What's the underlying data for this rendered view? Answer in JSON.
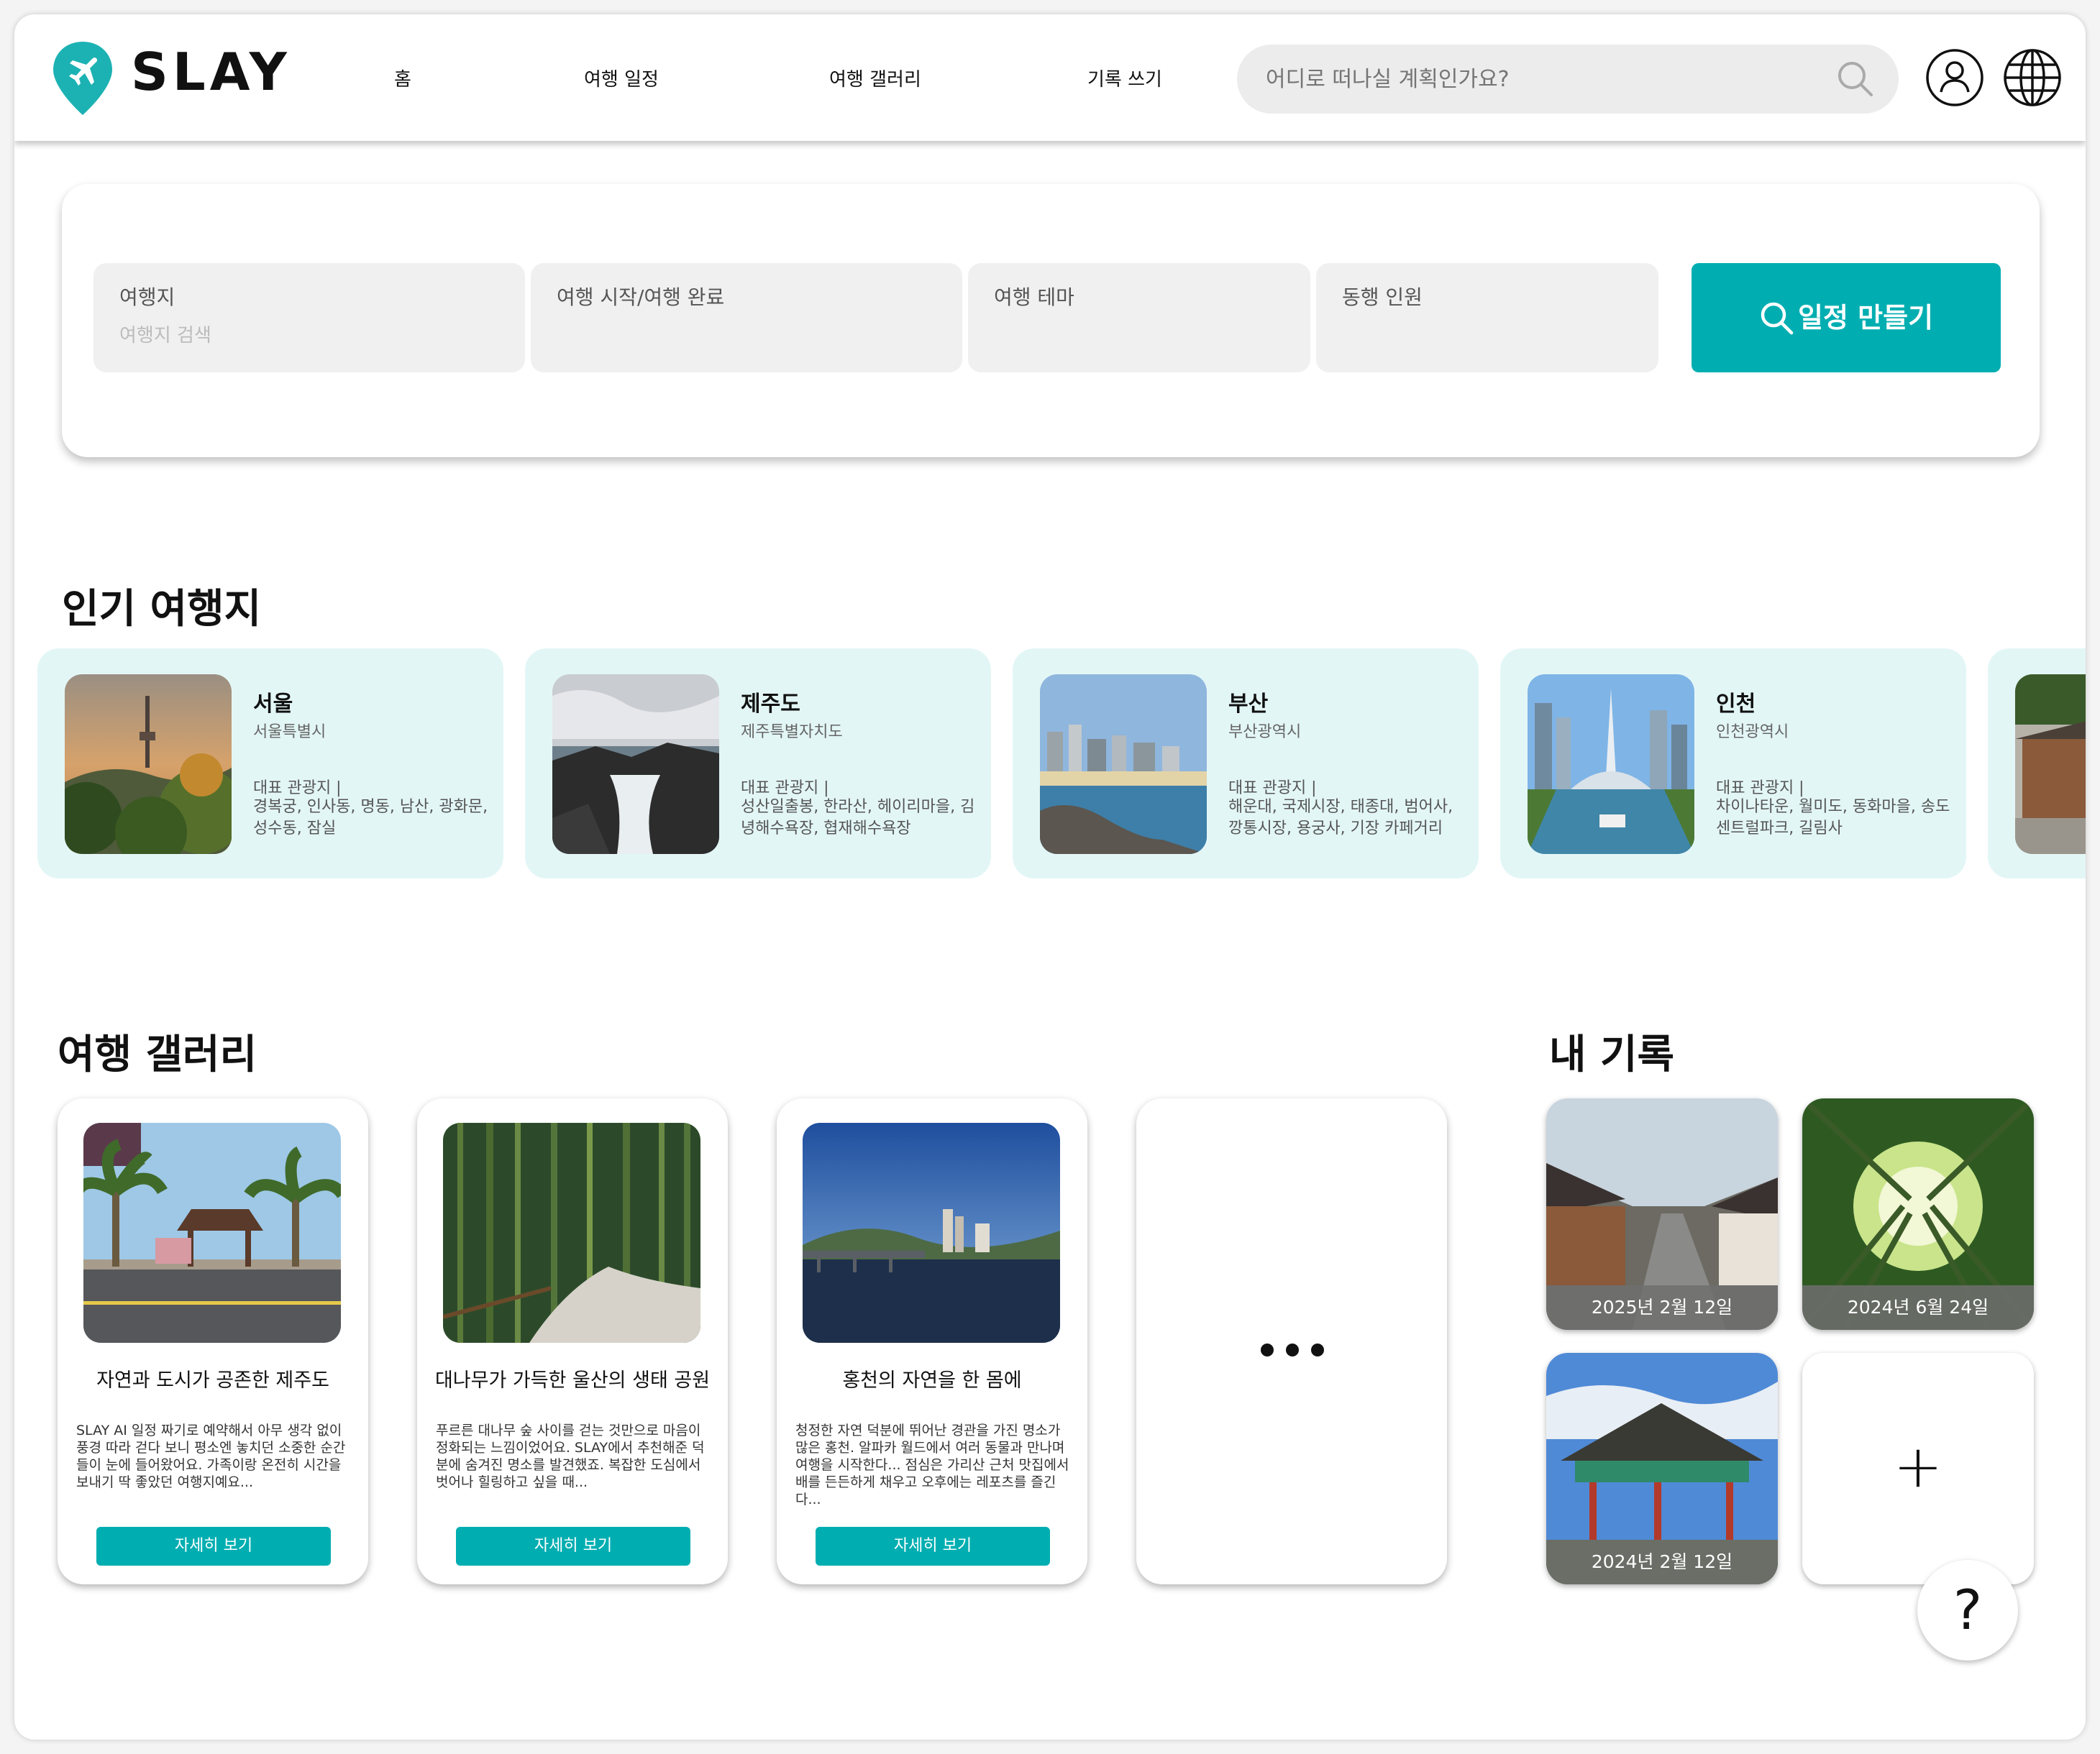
{
  "brand": {
    "name": "SLAY",
    "accent": "#00aeb1"
  },
  "nav": {
    "items": [
      "홈",
      "여행 일정",
      "여행 갤러리",
      "기록 쓰기"
    ]
  },
  "search": {
    "placeholder": "어디로 떠나실 계획인가요?"
  },
  "header_icons": [
    "search-icon",
    "user-icon",
    "globe-icon"
  ],
  "planner": {
    "destination": {
      "label": "여행지",
      "placeholder": "여행지 검색"
    },
    "dates": {
      "label": "여행 시작/여행 완료"
    },
    "theme": {
      "label": "여행 테마"
    },
    "companions": {
      "label": "동행 인원"
    },
    "create_button": "일정 만들기"
  },
  "popular": {
    "title": "인기 여행지",
    "items": [
      {
        "name": "서울",
        "region": "서울특별시",
        "highlight": "대표 관광지 |",
        "spots": "경복궁, 인사동, 명동, 남산, 광화문, 성수동, 잠실"
      },
      {
        "name": "제주도",
        "region": "제주특별자치도",
        "highlight": "대표 관광지 |",
        "spots": "성산일출봉, 한라산, 헤이리마을, 김녕해수욕장, 협재해수욕장"
      },
      {
        "name": "부산",
        "region": "부산광역시",
        "highlight": "대표 관광지 |",
        "spots": "해운대, 국제시장, 태종대, 범어사, 깡통시장, 용궁사, 기장 카페거리"
      },
      {
        "name": "인천",
        "region": "인천광역시",
        "highlight": "대표 관광지 |",
        "spots": "차이나타운, 월미도, 동화마을, 송도 센트럴파크, 길림사"
      }
    ]
  },
  "gallery": {
    "title": "여행 갤러리",
    "items": [
      {
        "title": "자연과 도시가 공존한 제주도",
        "desc": "SLAY AI 일정 짜기로 예약해서 아무 생각 없이 풍경 따라 걷다 보니 평소엔 놓치던 소중한 순간들이 눈에 들어왔어요. 가족이랑 온전히 시간을 보내기 딱 좋았던 여행지예요...",
        "button": "자세히 보기"
      },
      {
        "title": "대나무가 가득한 울산의 생태 공원",
        "desc": "푸르른 대나무 숲 사이를 걷는 것만으로 마음이 정화되는 느낌이었어요. SLAY에서 추천해준 덕분에 숨겨진 명소를 발견했죠. 복잡한 도심에서 벗어나 힐링하고 싶을 때...",
        "button": "자세히 보기"
      },
      {
        "title": "홍천의 자연을 한 몸에",
        "desc": "청정한 자연 덕분에 뛰어난 경관을 가진 명소가 많은 홍천. 알파카 월드에서 여러 동물과 만나며 여행을 시작한다... 점심은 가리산 근처 맛집에서 배를 든든하게 채우고 오후에는 레포츠를 즐긴다...",
        "button": "자세히 보기"
      }
    ],
    "more": "more-icon"
  },
  "records": {
    "title": "내 기록",
    "items": [
      {
        "date": "2025년 2월 12일"
      },
      {
        "date": "2024년 6월 24일"
      },
      {
        "date": "2024년 2월 12일"
      }
    ],
    "add": "+"
  },
  "help": {
    "label": "?"
  }
}
